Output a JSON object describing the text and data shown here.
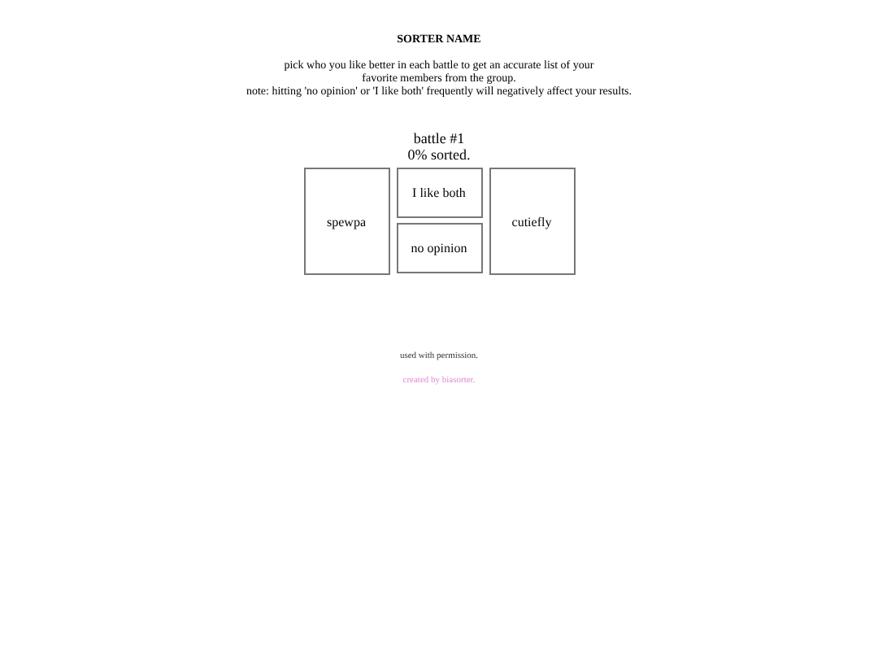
{
  "title": "SORTER NAME",
  "intro": [
    "pick who you like better in each battle to get an accurate list of your",
    "favorite members from the group.",
    "note: hitting 'no opinion' or 'I like both' frequently will negatively affect your results."
  ],
  "battle": "battle #1",
  "progress": "0% sorted.",
  "left": "spewpa",
  "both": "I like both",
  "none": "no opinion",
  "right": "cutiefly",
  "permission": "used with permission.",
  "credit": "created by biasorter."
}
